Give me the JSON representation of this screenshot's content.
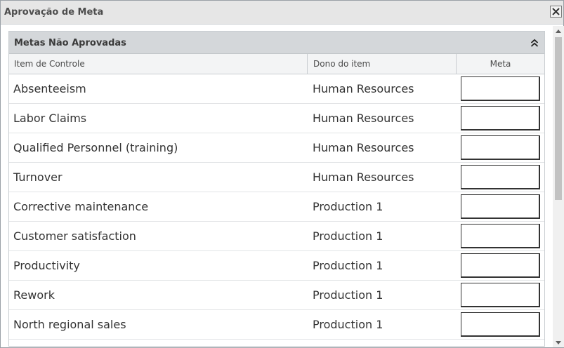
{
  "window": {
    "title": "Aprovação de Meta"
  },
  "panel": {
    "title": "Metas Não Aprovadas"
  },
  "columns": {
    "item": "Item de Controle",
    "owner": "Dono do item",
    "meta": "Meta"
  },
  "rows": [
    {
      "item": "Absenteeism",
      "owner": "Human Resources",
      "meta": ""
    },
    {
      "item": "Labor Claims",
      "owner": "Human Resources",
      "meta": ""
    },
    {
      "item": "Qualified Personnel (training)",
      "owner": "Human Resources",
      "meta": ""
    },
    {
      "item": "Turnover",
      "owner": "Human Resources",
      "meta": ""
    },
    {
      "item": "Corrective maintenance",
      "owner": "Production 1",
      "meta": ""
    },
    {
      "item": "Customer satisfaction",
      "owner": "Production 1",
      "meta": ""
    },
    {
      "item": "Productivity",
      "owner": "Production 1",
      "meta": ""
    },
    {
      "item": "Rework",
      "owner": "Production 1",
      "meta": ""
    },
    {
      "item": "North regional sales",
      "owner": "Production 1",
      "meta": ""
    }
  ],
  "icons": {
    "close": "close-icon",
    "collapse": "double-chevron-up-icon",
    "scroll_up": "scroll-up-arrow-icon",
    "scroll_down": "scroll-down-arrow-icon"
  },
  "colors": {
    "title_bar": "#e6e6e6",
    "panel_header": "#d4d7da",
    "column_header": "#f3f4f5",
    "border": "#c9cdd1",
    "text": "#333333"
  }
}
